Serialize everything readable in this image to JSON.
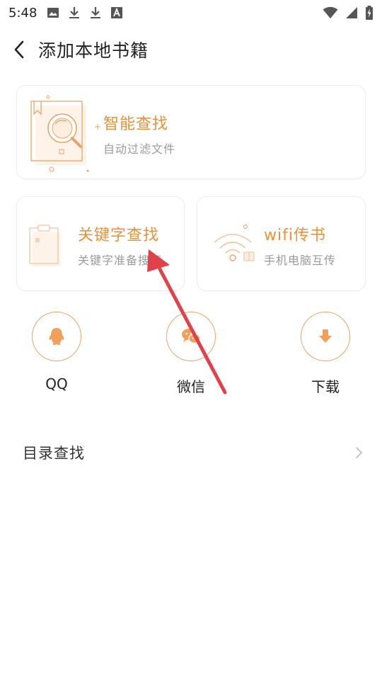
{
  "status_bar": {
    "time": "5:48",
    "left_icons": [
      "image-icon",
      "download-icon",
      "download-icon",
      "text-icon"
    ],
    "right_icons": [
      "wifi-icon",
      "signal-icon",
      "battery-charging-icon"
    ]
  },
  "header": {
    "title": "添加本地书籍",
    "back_icon": "chevron-left-icon"
  },
  "cards": {
    "smart": {
      "title": "智能查找",
      "subtitle": "自动过滤文件"
    },
    "keyword": {
      "title": "关键字查找",
      "subtitle": "关键字准备搜索"
    },
    "wifi": {
      "title": "wifi传书",
      "subtitle": "手机电脑互传"
    }
  },
  "quick_actions": [
    {
      "label": "QQ",
      "icon": "qq-icon"
    },
    {
      "label": "微信",
      "icon": "wechat-icon"
    },
    {
      "label": "下载",
      "icon": "download-icon"
    }
  ],
  "directory": {
    "label": "目录查找",
    "icon": "chevron-right-icon"
  },
  "colors": {
    "accent": "#e8923a",
    "annotation_arrow": "#e0414a"
  }
}
